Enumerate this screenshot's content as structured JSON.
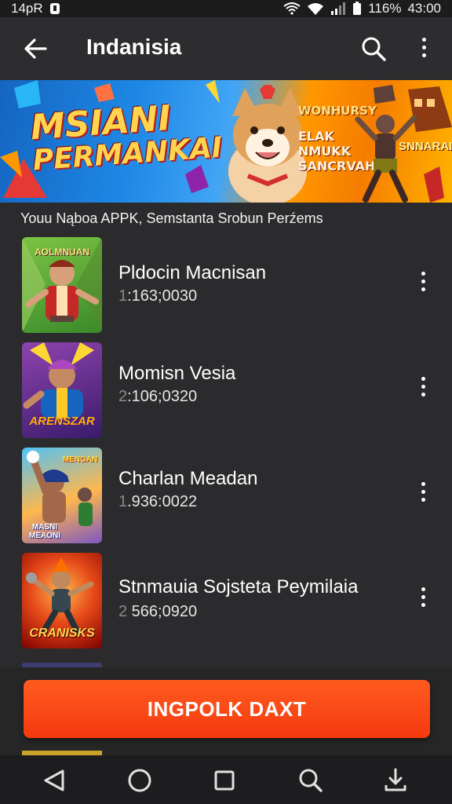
{
  "status_bar": {
    "left_text": "14pR",
    "battery": "116%",
    "time": "43:00"
  },
  "app_bar": {
    "title": "Indanisia"
  },
  "banner": {
    "line1": "MSIANI",
    "line2": "PERMANKAI",
    "right_text_1": "WONHURSY",
    "right_text_2": "ELAK NMUKK SANCRVAHL",
    "right_text_3": "SNNARAI"
  },
  "subtitle": "Youu Nąboa   APPK, Semstanta Srobun Perźems",
  "list": {
    "items": [
      {
        "title": "Pldocin Macnisan",
        "sub_prefix": "1",
        "sub_rest": ":163;0030",
        "thumb_label_top": "AOLMNUAN",
        "thumb_colors": [
          "#64b43a",
          "#2e7d32"
        ]
      },
      {
        "title": "Momisn Vesia",
        "sub_prefix": "2",
        "sub_rest": ":106;0320",
        "thumb_label_bottom": "ARENSZAR",
        "thumb_colors": [
          "#7b3fa0",
          "#3a1b6b"
        ]
      },
      {
        "title": "Charlan Meadan",
        "sub_prefix": "1",
        "sub_rest": ".936:0022",
        "thumb_label_top": "MENGAN",
        "thumb_label_bottom": "MASNI MEAONI",
        "thumb_colors": [
          "#4fc3f7",
          "#7e57c2"
        ]
      },
      {
        "title": "Stnmauia Sojsteta Peymilaia",
        "sub_prefix": "2",
        "sub_rest": " 566;0920",
        "thumb_label_bottom": "CRANISKS",
        "thumb_colors": [
          "#ff7043",
          "#b71c1c"
        ]
      }
    ]
  },
  "cta": {
    "label": "INGPOLK DAXT"
  },
  "colors": {
    "background": "#2b2b2d",
    "accent": "#f4441a"
  },
  "nav": {
    "icons": [
      "back-triangle-icon",
      "home-circle-icon",
      "recents-square-icon",
      "search-icon",
      "download-icon"
    ]
  }
}
